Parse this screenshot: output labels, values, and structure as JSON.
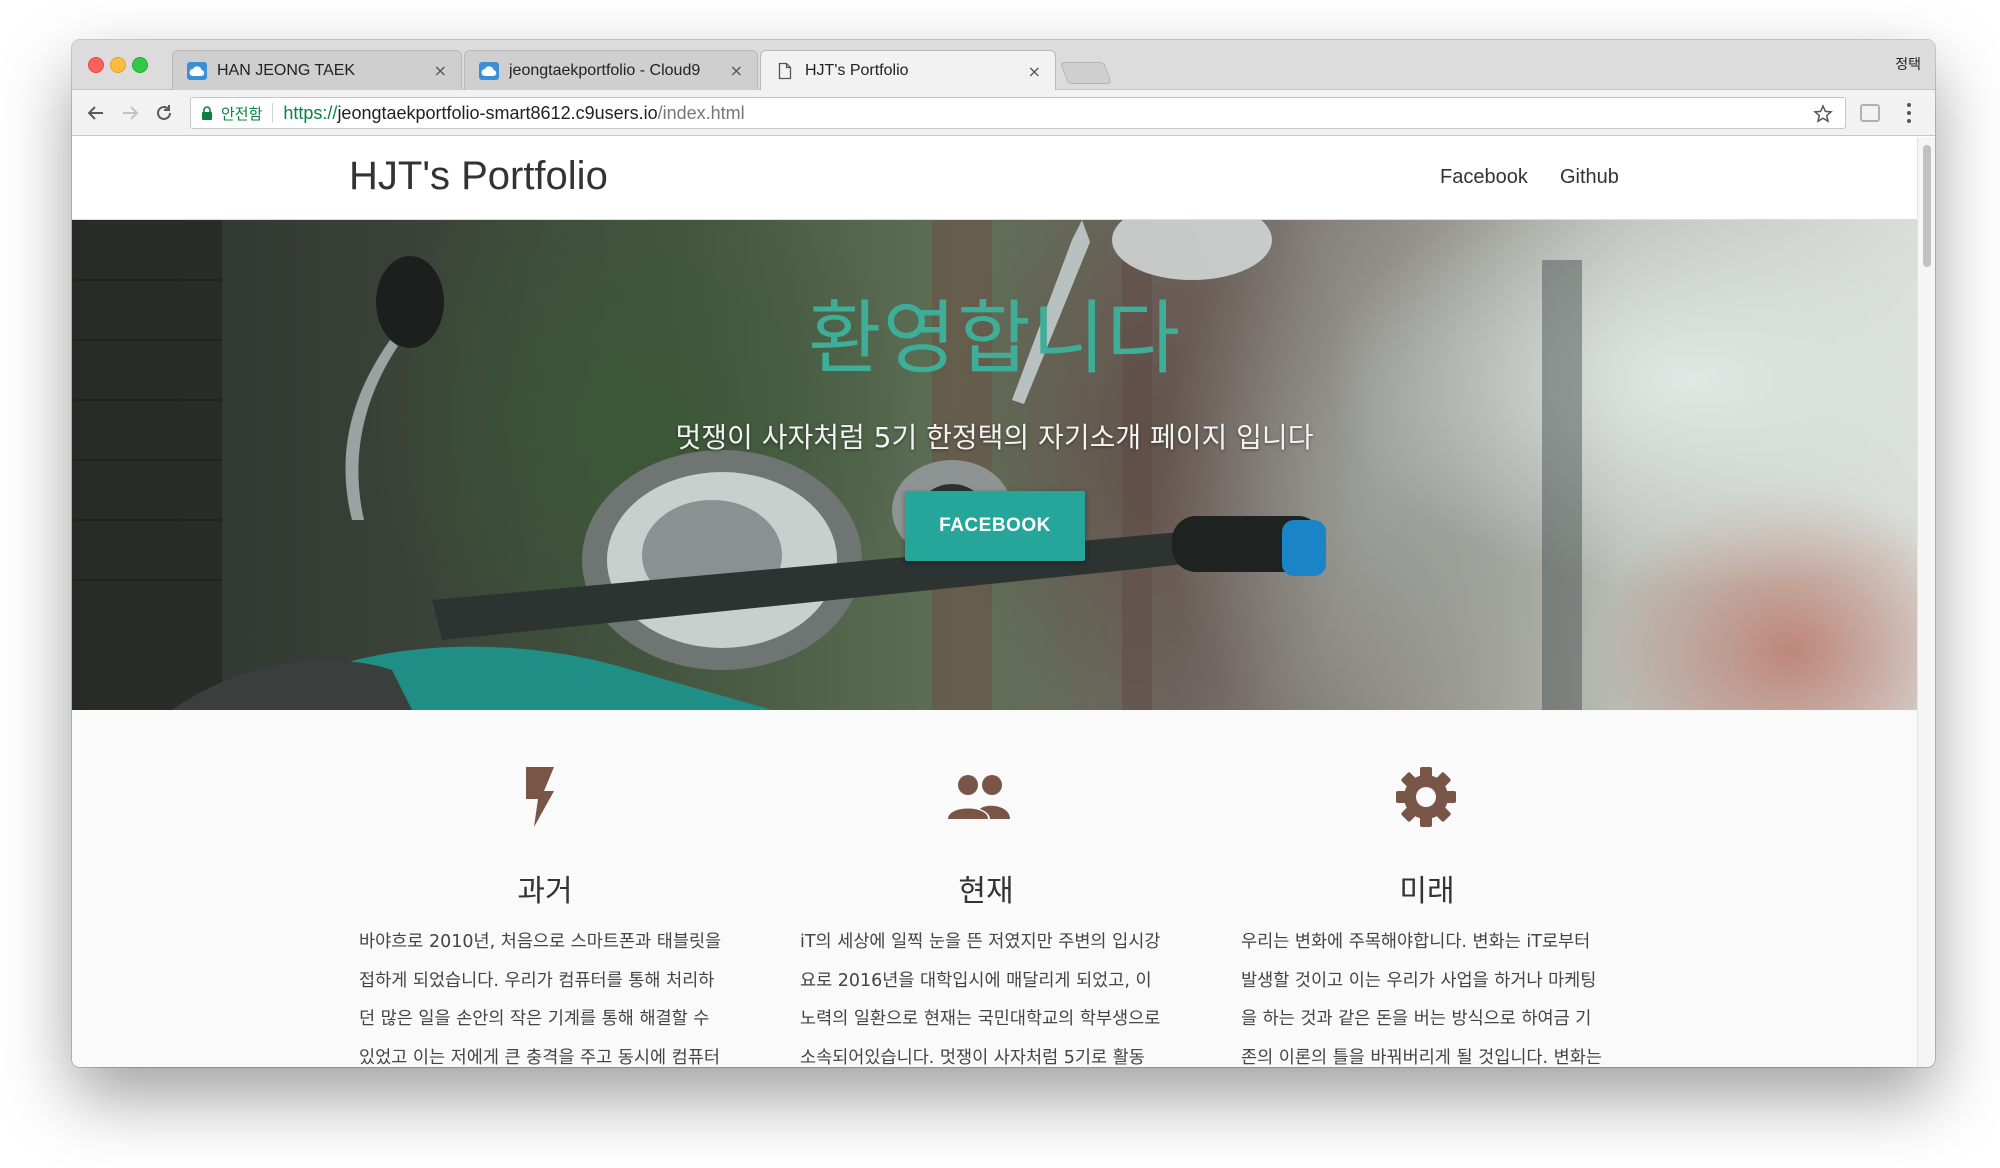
{
  "browser": {
    "tabs": [
      {
        "title": "HAN JEONG TAEK",
        "icon": "cloud9-icon"
      },
      {
        "title": "jeongtaekportfolio - Cloud9",
        "icon": "cloud9-icon"
      },
      {
        "title": "HJT's Portfolio",
        "icon": "document-icon"
      }
    ],
    "close_symbol": "×",
    "profile_name": "정택",
    "security_label": "안전함",
    "url": {
      "scheme": "https://",
      "host": "jeongtaekportfolio-smart8612.c9users.io",
      "path": "/index.html"
    }
  },
  "site": {
    "brand": "HJT's Portfolio",
    "nav": [
      "Facebook",
      "Github"
    ]
  },
  "hero": {
    "title": "환영합니다",
    "subtitle": "멋쟁이 사자처럼 5기 한정택의 자기소개 페이지 입니다",
    "button_label": "FACEBOOK",
    "button_color": "#26a69a",
    "title_color": "#3fae98"
  },
  "features": [
    {
      "icon": "flash-icon",
      "title": "과거",
      "body": "바야흐로 2010년, 처음으로 스마트폰과 태블릿을\n접하게 되었습니다. 우리가 컴퓨터를 통해 처리하\n던 많은 일을 손안의 작은 기계를 통해 해결할 수\n있었고 이는 저에게 큰 충격을 주고 동시에 컴퓨터"
    },
    {
      "icon": "group-icon",
      "title": "현재",
      "body": "iT의 세상에 일찍 눈을 뜬 저였지만 주변의 입시강\n요로 2016년을 대학입시에 매달리게 되었고, 이\n노력의 일환으로 현재는 국민대학교의 학부생으로\n소속되어있습니다. 멋쟁이 사자처럼 5기로 활동"
    },
    {
      "icon": "settings-icon",
      "title": "미래",
      "body": "우리는 변화에 주목해야합니다. 변화는 iT로부터\n발생할 것이고 이는 우리가 사업을 하거나 마케팅\n을 하는 것과 같은 돈을 버는 방식으로 하여금 기\n존의 이론의 틀을 바꿔버리게 될 것입니다. 변화는"
    }
  ],
  "colors": {
    "feature_icon": "#795548",
    "url_secure": "#0b8043"
  }
}
